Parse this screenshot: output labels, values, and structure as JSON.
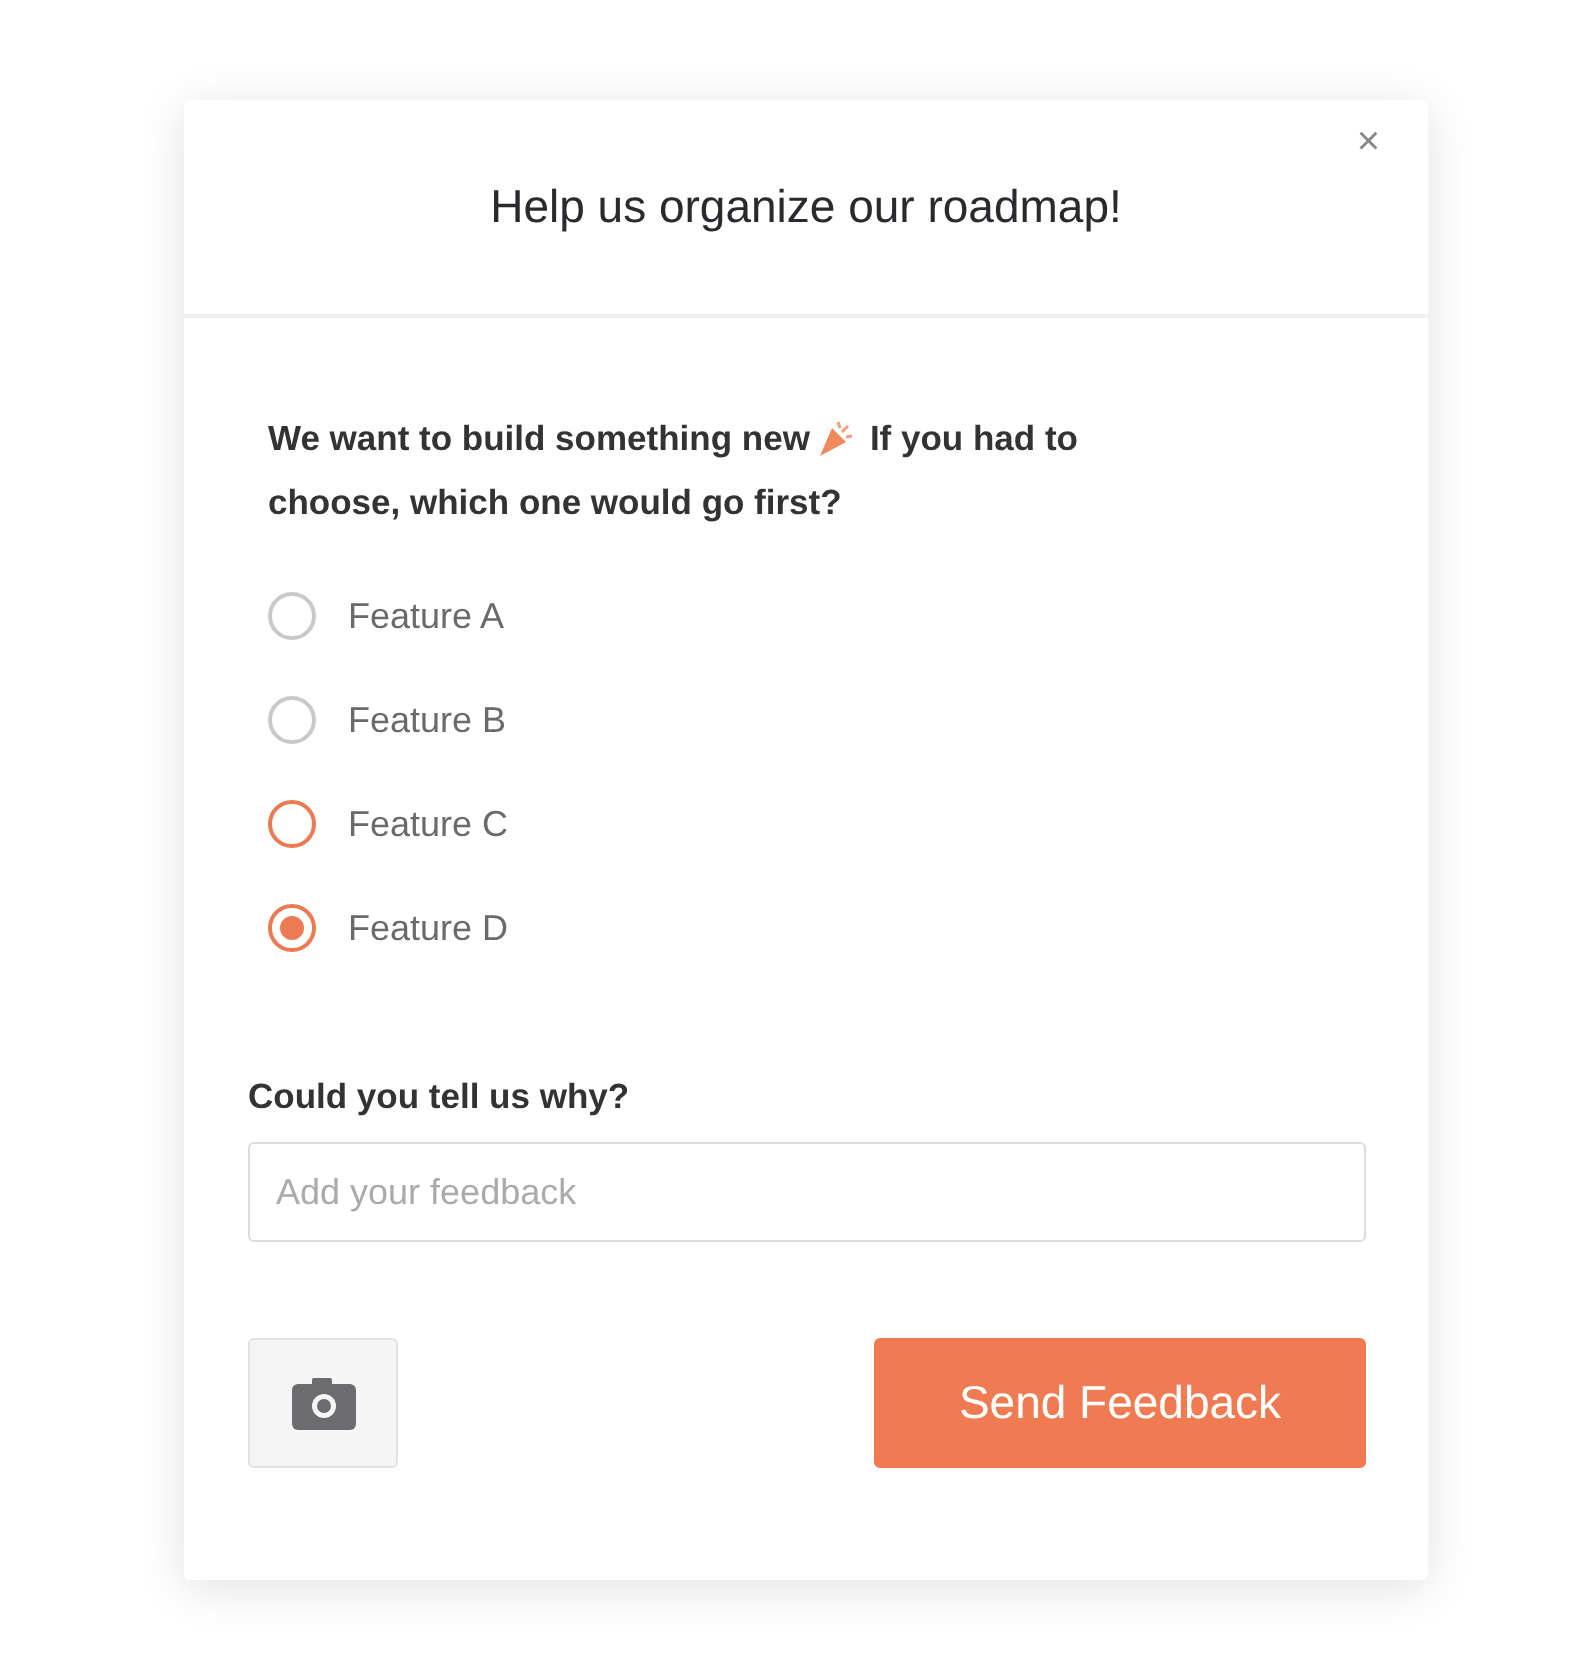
{
  "dialog": {
    "title": "Help us organize our roadmap!",
    "close": "×"
  },
  "question": {
    "line_1_start": "We want to build something new",
    "line_1_end": "If you had to",
    "line_2": "choose, which one would go first?"
  },
  "options": [
    {
      "label": "Feature A",
      "selected": false,
      "color": "#c9c9c9"
    },
    {
      "label": "Feature B",
      "selected": false,
      "color": "#c9c9c9"
    },
    {
      "label": "Feature C",
      "selected": false,
      "color": "#ec7a52"
    },
    {
      "label": "Feature D",
      "selected": true,
      "color": "#ec7a52"
    }
  ],
  "feedback": {
    "label": "Could you tell us why?",
    "placeholder": "Add your feedback"
  },
  "buttons": {
    "send": "Send Feedback"
  }
}
